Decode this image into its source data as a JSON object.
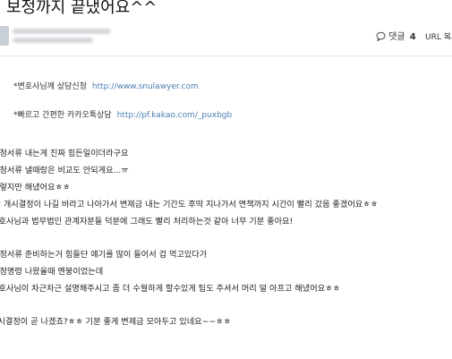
{
  "post": {
    "title": "보정까지 끝냈어요^^",
    "comment_label": "댓글",
    "comment_count": "4",
    "url_label": "URL 복사"
  },
  "links": [
    {
      "label": "*변호사님께 상담신청",
      "url": "http://www.snulawyer.com"
    },
    {
      "label": "*빠르고 간편한 카카오톡상담",
      "url": "http://pf.kakao.com/_puxbgb"
    }
  ],
  "body_lines": [
    "신청서류 내는게 진짜 힘든일이더라구요",
    "신청서류 낼때랑은 비교도 안되게요...ㅠ",
    "그렇지만 해냈어요ㅎㅎ",
    "이제 개시결정이 나길 바라고 나아가서 변제금 내는 기간도 후딱 지나가서 면책까지 시간이 빨리 갔음 좋겠어요ㅎㅎ",
    "변호사님과 법무법인 관계자분들 덕분에 그래도 빨리 처리하는것 같아 너무 기분 좋아요!",
    "보정서류 준비하는거 힘들단 얘기를 많이 들어서 겁 먹고있다가",
    "보정명령 나왔을때 멘붕이었는데",
    "변호사님이 차근차근 설명해주시고 좀 더 수월하게 할수있게 팁도 주셔서 머리 덜 아프고 해냈어요ㅎㅎ",
    "개시결정이 곧 나겠죠?ㅎㅎ 기분 좋게 변제금 모아두고 있네요~~ㅎㅎ"
  ]
}
